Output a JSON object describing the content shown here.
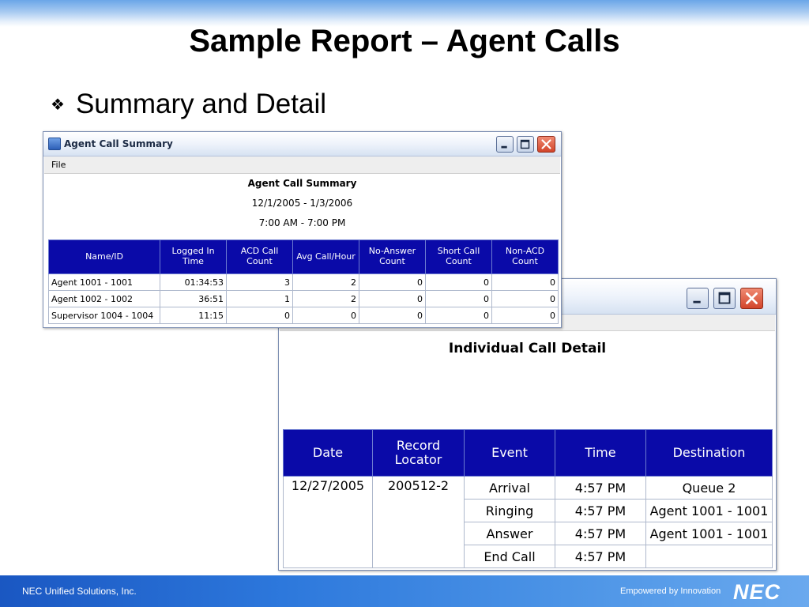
{
  "slide": {
    "title": "Sample Report – Agent Calls",
    "bullet_icon": "❖",
    "bullet_text": "Summary and Detail"
  },
  "summary_window": {
    "title": "Agent Call Summary",
    "menu": [
      "File"
    ],
    "report_title": "Agent Call Summary",
    "date_range": "12/1/2005 - 1/3/2006",
    "time_range": "7:00 AM - 7:00 PM",
    "columns": [
      "Name/ID",
      "Logged In Time",
      "ACD Call Count",
      "Avg Call/Hour",
      "No-Answer Count",
      "Short Call Count",
      "Non-ACD Count"
    ],
    "rows": [
      [
        "Agent 1001 - 1001",
        "01:34:53",
        "3",
        "2",
        "0",
        "0",
        "0"
      ],
      [
        "Agent 1002 - 1002",
        "36:51",
        "1",
        "2",
        "0",
        "0",
        "0"
      ],
      [
        "Supervisor 1004 - 1004",
        "11:15",
        "0",
        "0",
        "0",
        "0",
        "0"
      ]
    ]
  },
  "detail_window": {
    "report_title": "Individual Call Detail",
    "columns": [
      "Date",
      "Record Locator",
      "Event",
      "Time",
      "Destination"
    ],
    "date": "12/27/2005",
    "record_locator": "200512-2",
    "events": [
      {
        "event": "Arrival",
        "time": "4:57 PM",
        "destination": "Queue 2"
      },
      {
        "event": "Ringing",
        "time": "4:57 PM",
        "destination": "Agent 1001 - 1001"
      },
      {
        "event": "Answer",
        "time": "4:57 PM",
        "destination": "Agent 1001 - 1001"
      },
      {
        "event": "End Call",
        "time": "4:57 PM",
        "destination": ""
      }
    ]
  },
  "footer": {
    "company": "NEC Unified Solutions, Inc.",
    "tagline": "Empowered by Innovation",
    "logo": "NEC"
  },
  "colors": {
    "table_header": "#0a0aa8",
    "footer_band": "#2d78dc",
    "close_button": "#d2452b"
  }
}
